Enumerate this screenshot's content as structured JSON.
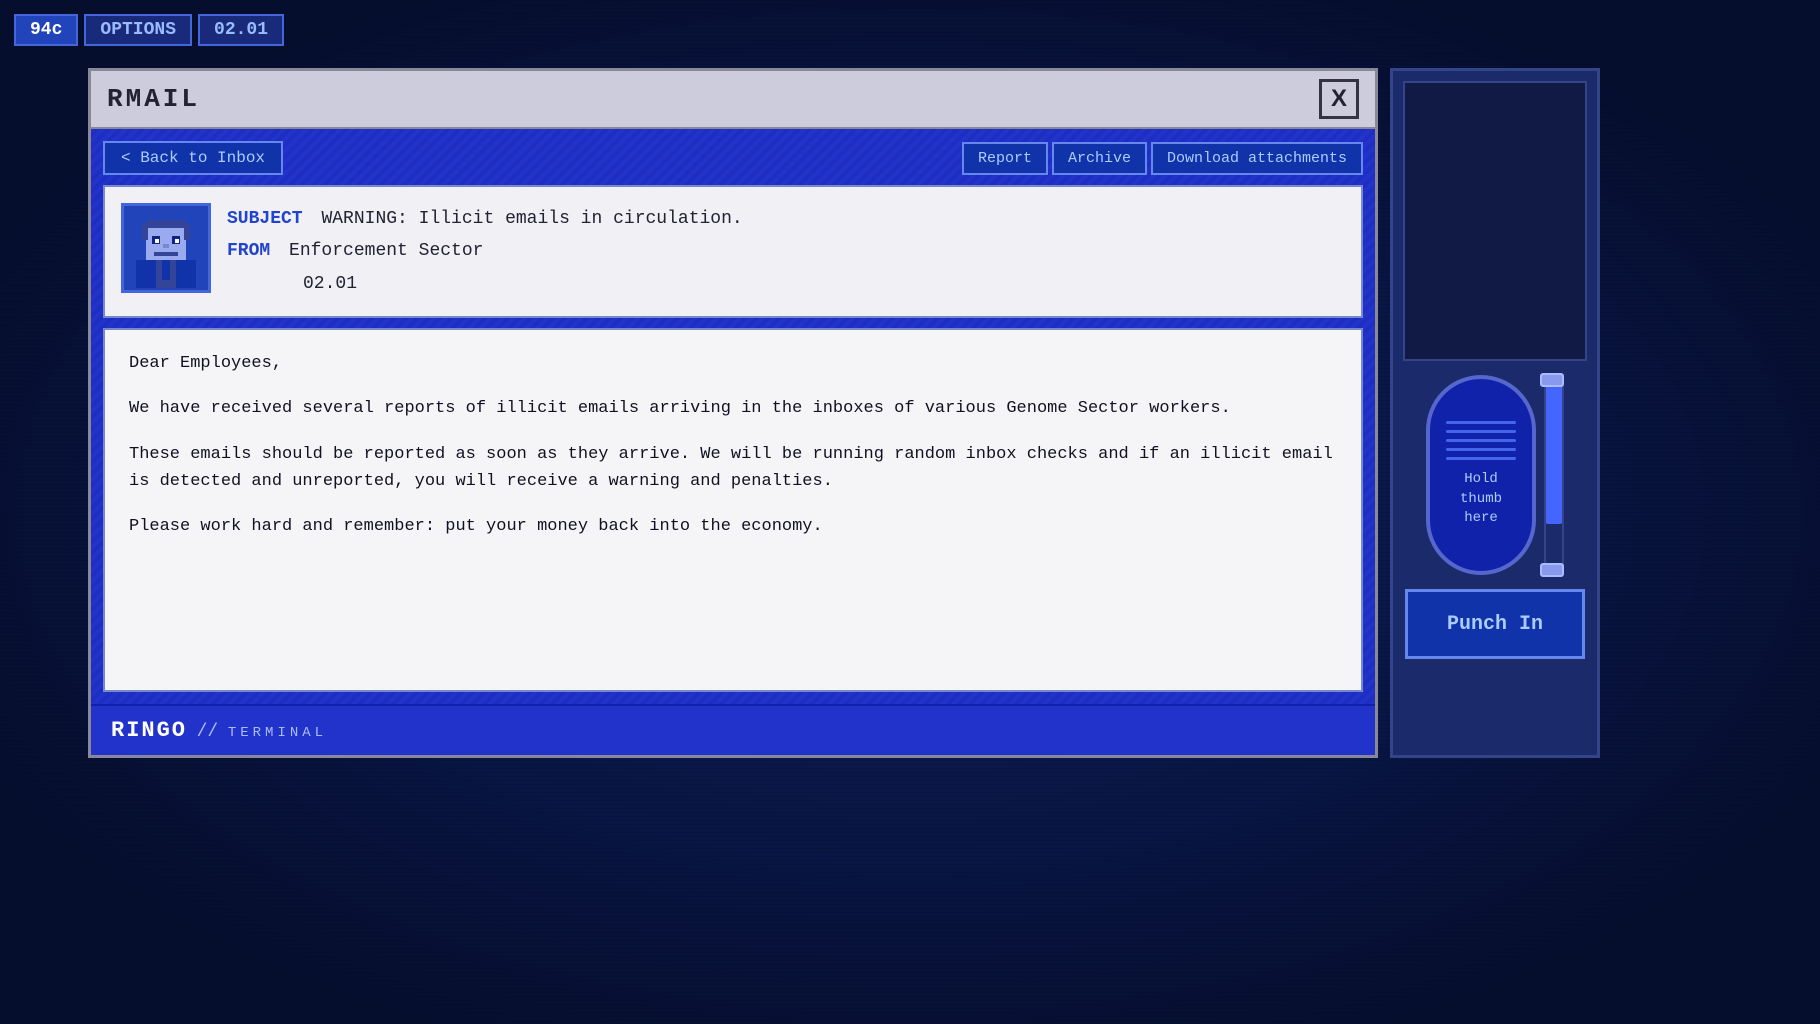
{
  "topbar": {
    "currency": "94c",
    "options_label": "OPTIONS",
    "time_label": "02.01"
  },
  "window": {
    "title": "RMAIL",
    "close_label": "X",
    "back_label": "< Back to Inbox",
    "action_buttons": [
      "Report",
      "Archive",
      "Download attachments"
    ],
    "email": {
      "subject_label": "SUBJECT",
      "from_label": "FROM",
      "subject_text": "WARNING: Illicit emails in circulation.",
      "from_name": "Enforcement Sector",
      "from_date": "02.01",
      "body_paragraphs": [
        "Dear Employees,",
        "We have received several reports of illicit emails arriving in the inboxes of various Genome Sector workers.",
        "These emails should be reported as soon as they arrive. We will be running random inbox checks and if an illicit email is detected and unreported, you will receive a warning and penalties.",
        "Please work hard and remember: put your money back into the economy."
      ]
    },
    "brand": {
      "main": "RINGO",
      "slash": "//",
      "sub": "TERMINAL"
    }
  },
  "right_panel": {
    "thumb_label": "Hold\nthumb\nhere",
    "punch_label": "Punch In"
  }
}
